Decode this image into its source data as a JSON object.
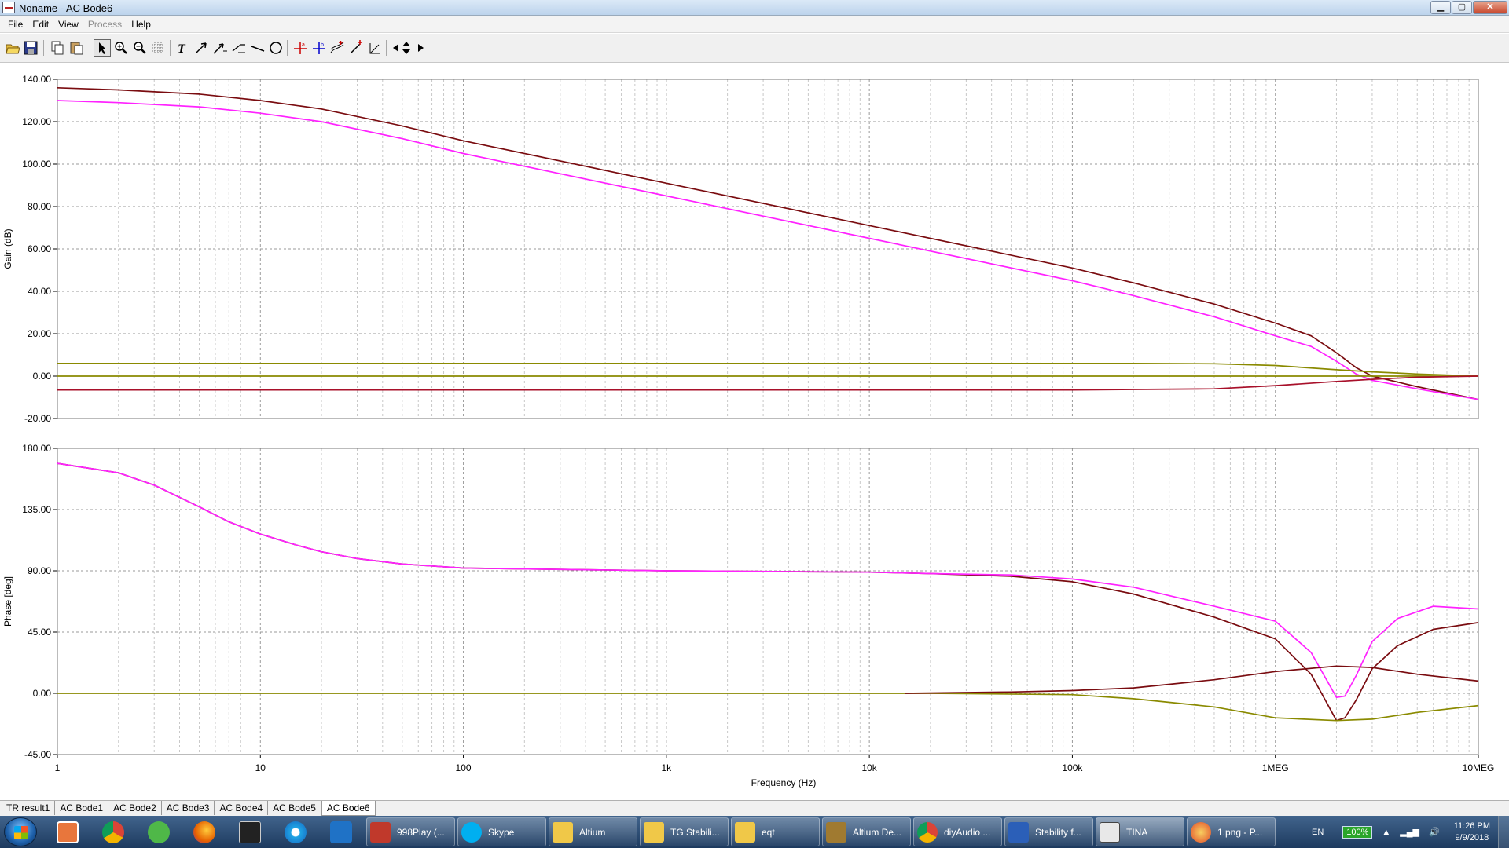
{
  "window": {
    "title": "Noname - AC Bode6",
    "buttons": {
      "minimize": "▁",
      "maximize": "▢",
      "close": "✕"
    }
  },
  "menu": {
    "items": [
      "File",
      "Edit",
      "View",
      "Process",
      "Help"
    ],
    "disabled": [
      "Process"
    ]
  },
  "toolbar": {
    "icons": [
      "open-icon",
      "save-icon",
      "copy-icon",
      "paste-icon",
      "pointer-icon",
      "zoom-in-icon",
      "zoom-out-icon",
      "grid-icon",
      "text-icon",
      "arrow-icon",
      "arrow-label-icon",
      "dim-label-icon",
      "line-icon",
      "circle-icon",
      "cursor-a-icon",
      "cursor-b-icon",
      "curve-add-icon",
      "curve-marker-icon",
      "tangent-icon",
      "scroll-horizontal-icon",
      "scroll-vertical-icon",
      "scroll-right-icon"
    ]
  },
  "plot": {
    "xlabel": "Frequency (Hz)",
    "x_ticks": [
      "1",
      "10",
      "100",
      "1k",
      "10k",
      "100k",
      "1MEG",
      "10MEG"
    ],
    "gain": {
      "ylabel": "Gain (dB)",
      "y_ticks": [
        "140.00",
        "120.00",
        "100.00",
        "80.00",
        "60.00",
        "40.00",
        "20.00",
        "0.00",
        "-20.00"
      ]
    },
    "phase": {
      "ylabel": "Phase [deg]",
      "y_ticks": [
        "180.00",
        "135.00",
        "90.00",
        "45.00",
        "0.00",
        "-45.00"
      ]
    }
  },
  "chart_data": [
    {
      "type": "line",
      "xlabel": "Frequency (Hz)",
      "ylabel": "Gain (dB)",
      "xscale": "log",
      "xlim": [
        1,
        10000000
      ],
      "ylim": [
        -20,
        140
      ],
      "grid": true,
      "series": [
        {
          "color": "#7a0c10",
          "x": [
            1,
            2,
            5,
            10,
            20,
            50,
            100,
            1000,
            10000,
            100000,
            200000,
            500000,
            1000000,
            1500000,
            2000000,
            2500000,
            3000000,
            5000000,
            10000000
          ],
          "y": [
            136,
            135,
            133,
            130,
            126,
            118,
            111,
            91,
            71,
            51,
            44,
            34,
            25,
            19,
            11,
            4,
            0,
            -5,
            -11
          ]
        },
        {
          "color": "#ff22ff",
          "x": [
            1,
            2,
            5,
            10,
            20,
            50,
            100,
            1000,
            10000,
            100000,
            200000,
            500000,
            1000000,
            1500000,
            2000000,
            2500000,
            3000000,
            5000000,
            10000000
          ],
          "y": [
            130,
            129,
            127,
            124,
            120,
            112,
            105,
            85,
            65,
            45,
            38,
            28,
            19,
            14,
            7,
            1,
            -2,
            -6,
            -11
          ]
        },
        {
          "color": "#8a8a00",
          "x": [
            1,
            100000,
            200000,
            500000,
            1000000,
            2000000,
            3000000,
            5000000,
            10000000
          ],
          "y": [
            6,
            6,
            6,
            5.8,
            5,
            3,
            2,
            1,
            0
          ]
        },
        {
          "color": "#8a8a00",
          "x": [
            1,
            10000000
          ],
          "y": [
            0,
            0
          ]
        },
        {
          "color": "#a8102a",
          "x": [
            1,
            100000,
            200000,
            500000,
            1000000,
            2000000,
            3000000,
            5000000,
            10000000
          ],
          "y": [
            -6.5,
            -6.5,
            -6.3,
            -6,
            -4.5,
            -2.5,
            -1.5,
            -0.5,
            0
          ]
        }
      ]
    },
    {
      "type": "line",
      "xlabel": "Frequency (Hz)",
      "ylabel": "Phase [deg]",
      "xscale": "log",
      "xlim": [
        1,
        10000000
      ],
      "ylim": [
        -45,
        180
      ],
      "grid": true,
      "series": [
        {
          "color": "#7a0c10",
          "x": [
            1,
            2,
            3,
            5,
            7,
            10,
            15,
            20,
            30,
            50,
            100,
            1000,
            10000,
            20000,
            50000,
            100000,
            200000,
            500000,
            1000000,
            1500000,
            2000000,
            2200000,
            2500000,
            3000000,
            4000000,
            6000000,
            10000000
          ],
          "y": [
            169,
            162,
            153,
            137,
            126,
            117,
            109,
            104,
            99,
            95,
            92,
            90,
            89,
            88,
            86,
            82,
            73,
            56,
            40,
            14,
            -20,
            -18,
            -5,
            18,
            35,
            47,
            52
          ]
        },
        {
          "color": "#ff22ff",
          "x": [
            1,
            2,
            3,
            5,
            7,
            10,
            15,
            20,
            30,
            50,
            100,
            1000,
            10000,
            20000,
            50000,
            100000,
            200000,
            500000,
            1000000,
            1500000,
            2000000,
            2200000,
            2500000,
            3000000,
            4000000,
            6000000,
            10000000
          ],
          "y": [
            169,
            162,
            153,
            137,
            126,
            117,
            109,
            104,
            99,
            95,
            92,
            90,
            89,
            88,
            87,
            84,
            78,
            64,
            53,
            30,
            -3,
            -2,
            13,
            38,
            55,
            64,
            62
          ]
        },
        {
          "color": "#8a8a00",
          "x": [
            1,
            20000,
            100000,
            200000,
            500000,
            1000000,
            2000000,
            3000000,
            5000000,
            10000000
          ],
          "y": [
            0,
            0,
            -1,
            -4,
            -10,
            -18,
            -20,
            -19,
            -14,
            -9
          ]
        },
        {
          "color": "#7a0c10",
          "x": [
            15000,
            50000,
            100000,
            200000,
            500000,
            1000000,
            2000000,
            3000000,
            5000000,
            10000000
          ],
          "y": [
            0,
            1,
            2,
            4,
            10,
            16,
            20,
            19,
            14,
            9
          ]
        }
      ]
    }
  ],
  "tabs": [
    "TR result1",
    "AC Bode1",
    "AC Bode2",
    "AC Bode3",
    "AC Bode4",
    "AC Bode5",
    "AC Bode6"
  ],
  "active_tab": "AC Bode6",
  "taskbar": {
    "pinned": [
      "explorer-icon",
      "chrome-icon",
      "hp-icon",
      "firefox-icon",
      "media-icon",
      "ie-icon",
      "vscode-icon"
    ],
    "tasks": [
      "998Play (...",
      "Skype",
      "Altium",
      "TG Stabili...",
      "eqt",
      "Altium De...",
      "diyAudio ...",
      "Stability f...",
      "TINA",
      "1.png - P..."
    ],
    "active_task": "TINA",
    "language": "EN",
    "battery": "100%",
    "time": "11:26 PM",
    "date": "9/9/2018"
  }
}
